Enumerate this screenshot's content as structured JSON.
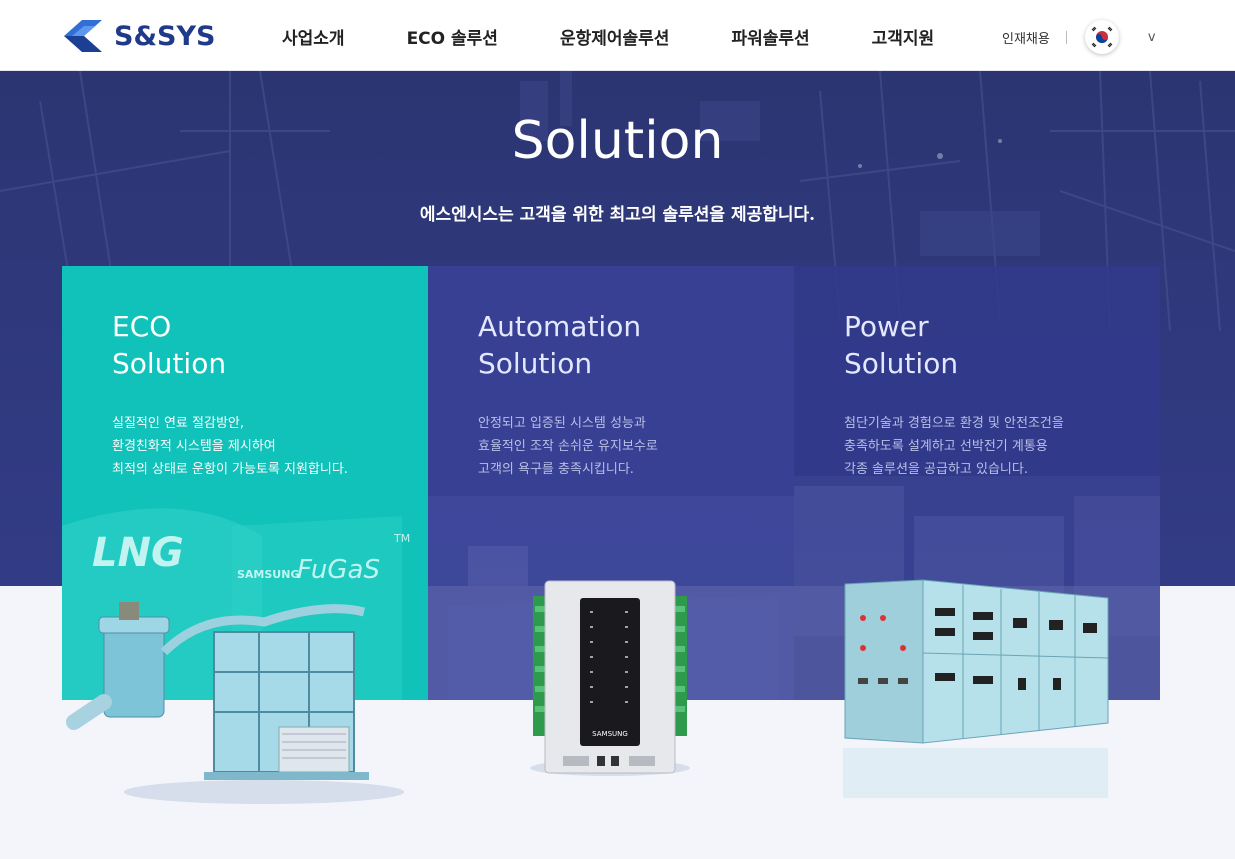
{
  "brand": {
    "name": "S&SYS"
  },
  "nav": {
    "items": [
      {
        "label": "사업소개"
      },
      {
        "label": "ECO 솔루션"
      },
      {
        "label": "운항제어솔루션"
      },
      {
        "label": "파워솔루션"
      },
      {
        "label": "고객지원"
      }
    ]
  },
  "utility": {
    "recruit": "인재채용",
    "lang_toggle": "v",
    "flag_icon": "korea-flag-icon"
  },
  "hero": {
    "title": "Solution",
    "subtitle": "에스엔시스는 고객을 위한 최고의 솔루션을 제공합니다."
  },
  "cards": [
    {
      "title_line1": "ECO",
      "title_line2": "Solution",
      "desc": [
        "실질적인 연료 절감방안,",
        "환경친화적 시스템을 제시하여",
        "최적의 상태로 운항이 가능토록 지원합니다."
      ],
      "image_text": [
        "LNG",
        "SAMSUNG",
        "FuGaS",
        "TM"
      ]
    },
    {
      "title_line1": "Automation",
      "title_line2": "Solution",
      "desc": [
        "안정되고 입증된 시스템 성능과",
        "효율적인 조작 손쉬운 유지보수로",
        "고객의 욕구를 충족시킵니다."
      ],
      "image_text": [
        "SAMSUNG"
      ]
    },
    {
      "title_line1": "Power",
      "title_line2": "Solution",
      "desc": [
        "첨단기술과 경험으로 환경 및 안전조건을",
        "충족하도록 설계하고 선박전기 계통용",
        "각종 솔루션을 공급하고 있습니다."
      ]
    }
  ],
  "colors": {
    "brand": "#203a8a",
    "eco": "#10c2b9",
    "hero": "#2b3470",
    "cardBlue": "#394298"
  }
}
